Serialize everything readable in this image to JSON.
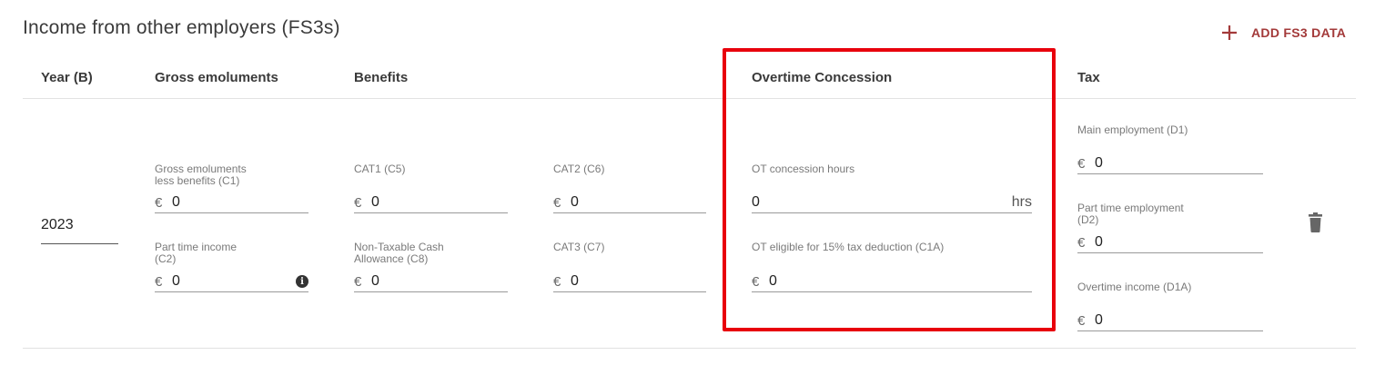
{
  "section": {
    "title": "Income from other employers (FS3s)",
    "add_button_label": "ADD FS3 DATA"
  },
  "columns": {
    "year": "Year (B)",
    "gross": "Gross emoluments",
    "benefits": "Benefits",
    "overtime": "Overtime Concession",
    "tax": "Tax"
  },
  "row": {
    "year": "2023",
    "gross_c1": {
      "label": "Gross emoluments\nless benefits (C1)",
      "currency": "€",
      "value": "0"
    },
    "part_time_c2": {
      "label": "Part time income\n(C2)",
      "currency": "€",
      "value": "0",
      "info_icon": "info-icon"
    },
    "cat1_c5": {
      "label": "CAT1 (C5)",
      "currency": "€",
      "value": "0"
    },
    "non_taxable_c8": {
      "label": "Non-Taxable Cash\nAllowance (C8)",
      "currency": "€",
      "value": "0"
    },
    "cat2_c6": {
      "label": "CAT2 (C6)",
      "currency": "€",
      "value": "0"
    },
    "cat3_c7": {
      "label": "CAT3 (C7)",
      "currency": "€",
      "value": "0"
    },
    "ot_hours": {
      "label": "OT concession hours",
      "value": "0",
      "suffix": "hrs"
    },
    "ot_eligible_c1a": {
      "label": "OT eligible for 15% tax deduction (C1A)",
      "currency": "€",
      "value": "0"
    },
    "main_employment_d1": {
      "label": "Main employment (D1)",
      "currency": "€",
      "value": "0"
    },
    "part_time_employment_d2": {
      "label": "Part time employment\n(D2)",
      "currency": "€",
      "value": "0"
    },
    "overtime_income_d1a": {
      "label": "Overtime income (D1A)",
      "currency": "€",
      "value": "0"
    }
  },
  "colors": {
    "accent": "#a33a3a",
    "highlight": "#e8000c"
  },
  "icons": {
    "add": "plus-icon",
    "info": "info-icon",
    "delete": "trash-icon"
  }
}
